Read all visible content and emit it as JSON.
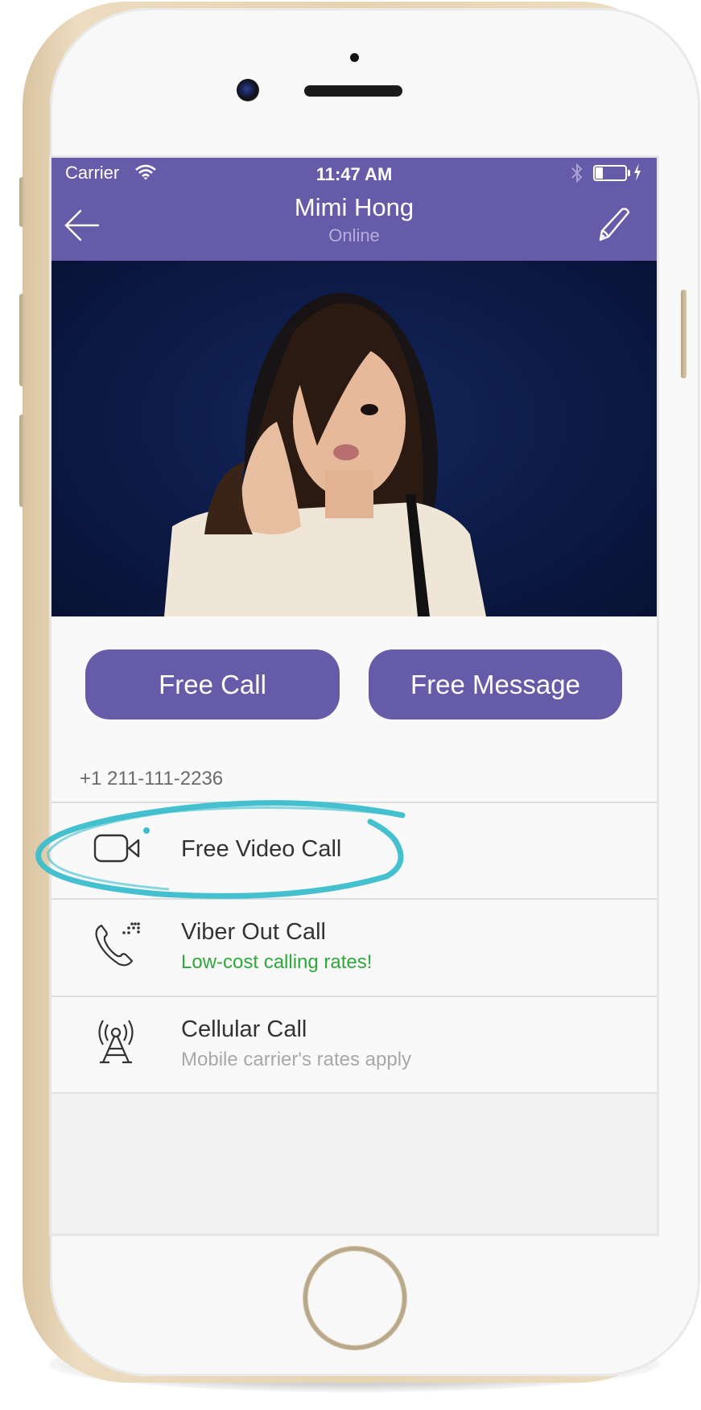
{
  "device": {
    "frame_color": "#e6d3b2",
    "icons": {
      "camera": "front-camera-icon",
      "speaker": "earpiece-speaker-icon",
      "sensor": "proximity-sensor-icon",
      "home": "home-button"
    }
  },
  "status_bar": {
    "carrier": "Carrier",
    "time": "11:47 AM",
    "battery_level_percent": 25,
    "icons": [
      "wifi-icon",
      "bluetooth-icon",
      "battery-icon",
      "charging-bolt-icon"
    ]
  },
  "header": {
    "title": "Mimi Hong",
    "subtitle": "Online",
    "back_icon": "back-arrow-icon",
    "edit_icon": "pencil-icon",
    "accent_color": "#665ba8"
  },
  "profile": {
    "photo_alt": "Contact photo"
  },
  "actions": {
    "free_call": "Free Call",
    "free_message": "Free Message"
  },
  "contact": {
    "phone_number": "+1 211-111-2236"
  },
  "call_options": [
    {
      "title": "Free Video Call",
      "subtitle": "",
      "icon": "video-camera-icon",
      "badge_color": "#3bbdcc"
    },
    {
      "title": "Viber Out Call",
      "subtitle": "Low-cost calling rates!",
      "subtitle_color": "#2ea83a",
      "icon": "phone-dots-icon"
    },
    {
      "title": "Cellular Call",
      "subtitle": "Mobile carrier's rates apply",
      "subtitle_color": "#a8a8a8",
      "icon": "cell-tower-icon"
    }
  ],
  "annotation": {
    "highlight_color": "#3bbdcc",
    "target": "Free Video Call"
  }
}
